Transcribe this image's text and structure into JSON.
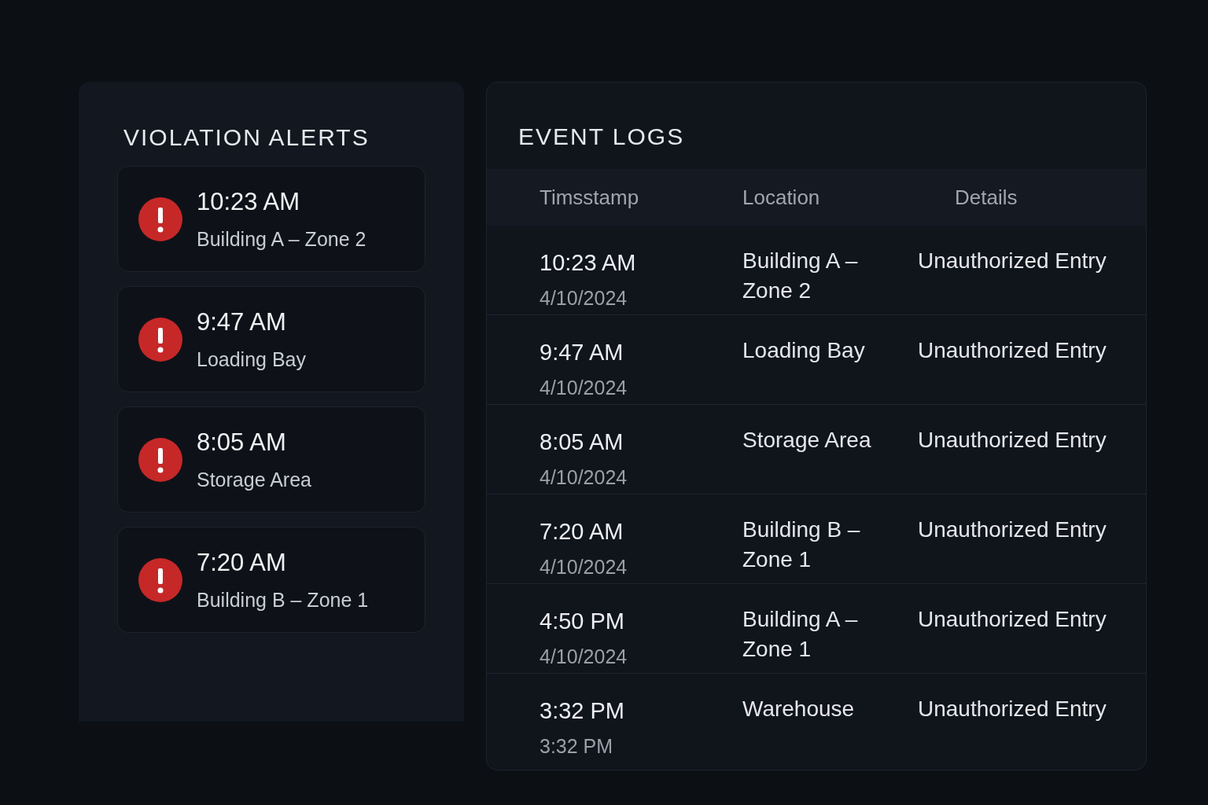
{
  "alerts_panel": {
    "title": "VIOLATION ALERTS",
    "alerts": [
      {
        "time": "10:23 AM",
        "location": "Building A – Zone 2"
      },
      {
        "time": "9:47 AM",
        "location": "Loading Bay"
      },
      {
        "time": "8:05 AM",
        "location": "Storage Area"
      },
      {
        "time": "7:20 AM",
        "location": "Building B – Zone 1"
      }
    ]
  },
  "event_logs": {
    "title": "EVENT LOGS",
    "columns": [
      "Timsstamp",
      "Location",
      "Details"
    ],
    "rows": [
      {
        "time": "10:23 AM",
        "date": "4/10/2024",
        "location": "Building A – Zone 2",
        "details": "Unauthorized Entry"
      },
      {
        "time": "9:47 AM",
        "date": "4/10/2024",
        "location": "Loading Bay",
        "details": "Unauthorized Entry"
      },
      {
        "time": "8:05 AM",
        "date": "4/10/2024",
        "location": "Storage Area",
        "details": "Unauthorized Entry"
      },
      {
        "time": "7:20 AM",
        "date": "4/10/2024",
        "location": "Building B – Zone 1",
        "details": "Unauthorized Entry"
      },
      {
        "time": "4:50 PM",
        "date": "4/10/2024",
        "location": "Building A – Zone 1",
        "details": "Unauthorized Entry"
      },
      {
        "time": "3:32 PM",
        "date": "3:32 PM",
        "location": "Warehouse",
        "details": "Unauthorized Entry"
      }
    ]
  }
}
